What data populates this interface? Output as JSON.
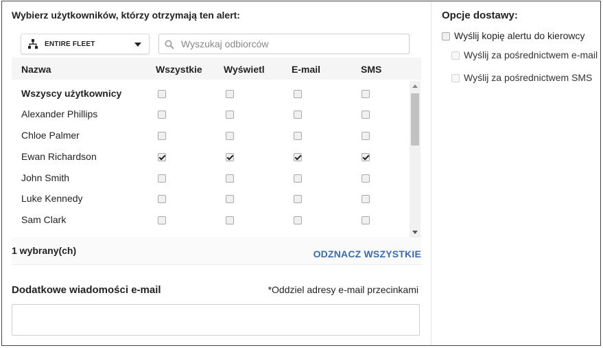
{
  "recipients": {
    "title": "Wybierz użytkowników, którzy otrzymają ten alert:",
    "fleet_dropdown": {
      "label": "ENTIRE FLEET"
    },
    "search": {
      "placeholder": "Wyszukaj odbiorców",
      "value": ""
    },
    "columns": [
      "Nazwa",
      "Wszystkie",
      "Wyświetl",
      "E-mail",
      "SMS"
    ],
    "rows": [
      {
        "name": "Wszyscy użytkownicy",
        "checks": [
          false,
          false,
          false,
          false
        ]
      },
      {
        "name": "Alexander Phillips",
        "checks": [
          false,
          false,
          false,
          false
        ]
      },
      {
        "name": "Chloe Palmer",
        "checks": [
          false,
          false,
          false,
          false
        ]
      },
      {
        "name": "Ewan Richardson",
        "checks": [
          true,
          true,
          true,
          true
        ]
      },
      {
        "name": "John Smith",
        "checks": [
          false,
          false,
          false,
          false
        ]
      },
      {
        "name": "Luke Kennedy",
        "checks": [
          false,
          false,
          false,
          false
        ]
      },
      {
        "name": "Sam Clark",
        "checks": [
          false,
          false,
          false,
          false
        ]
      },
      {
        "name": "",
        "checks": [
          false,
          false,
          false,
          false
        ]
      }
    ],
    "selected_count": "1 wybrany(ch)",
    "deselect_all": "ODZNACZ WSZYSTKIE"
  },
  "extra_emails": {
    "title": "Dodatkowe wiadomości e-mail",
    "hint": "*Oddziel adresy e-mail przecinkami",
    "value": ""
  },
  "delivery": {
    "title": "Opcje dostawy:",
    "options": [
      {
        "label": "Wyślij kopię alertu do kierowcy",
        "checked": false
      },
      {
        "label": "Wyślij za pośrednictwem e-mail",
        "checked": false
      },
      {
        "label": "Wyślij za pośrednictwem SMS",
        "checked": false
      }
    ]
  },
  "colors": {
    "accent_link": "#3a6aa8",
    "header_bg": "#f5f5f5",
    "border": "#444444"
  }
}
